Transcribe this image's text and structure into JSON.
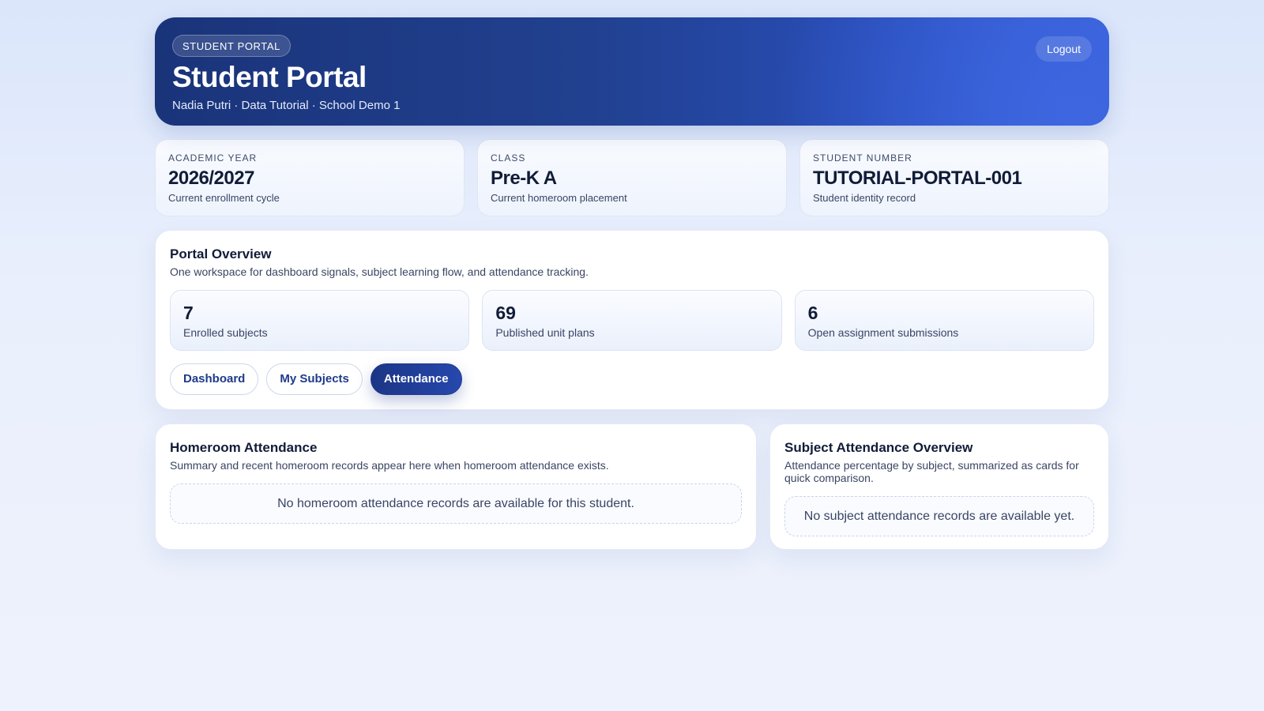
{
  "header": {
    "badge": "STUDENT PORTAL",
    "title": "Student Portal",
    "subtitle": "Nadia Putri · Data Tutorial · School Demo 1",
    "logout_label": "Logout"
  },
  "stats": [
    {
      "label": "ACADEMIC YEAR",
      "value": "2026/2027",
      "note": "Current enrollment cycle"
    },
    {
      "label": "CLASS",
      "value": "Pre-K A",
      "note": "Current homeroom placement"
    },
    {
      "label": "STUDENT NUMBER",
      "value": "TUTORIAL-PORTAL-001",
      "note": "Student identity record"
    }
  ],
  "overview": {
    "title": "Portal Overview",
    "description": "One workspace for dashboard signals, subject learning flow, and attendance tracking.",
    "metrics": [
      {
        "value": "7",
        "label": "Enrolled subjects"
      },
      {
        "value": "69",
        "label": "Published unit plans"
      },
      {
        "value": "6",
        "label": "Open assignment submissions"
      }
    ],
    "tabs": [
      {
        "label": "Dashboard",
        "active": false
      },
      {
        "label": "My Subjects",
        "active": false
      },
      {
        "label": "Attendance",
        "active": true
      }
    ]
  },
  "homeroom": {
    "title": "Homeroom Attendance",
    "description": "Summary and recent homeroom records appear here when homeroom attendance exists.",
    "empty_text": "No homeroom attendance records are available for this student."
  },
  "subject_attendance": {
    "title": "Subject Attendance Overview",
    "description": "Attendance percentage by subject, summarized as cards for quick comparison.",
    "empty_text": "No subject attendance records are available yet."
  },
  "colors": {
    "brand_dark": "#1c3585",
    "brand_accent": "#3a60d8",
    "page_bg": "#e9effc"
  }
}
